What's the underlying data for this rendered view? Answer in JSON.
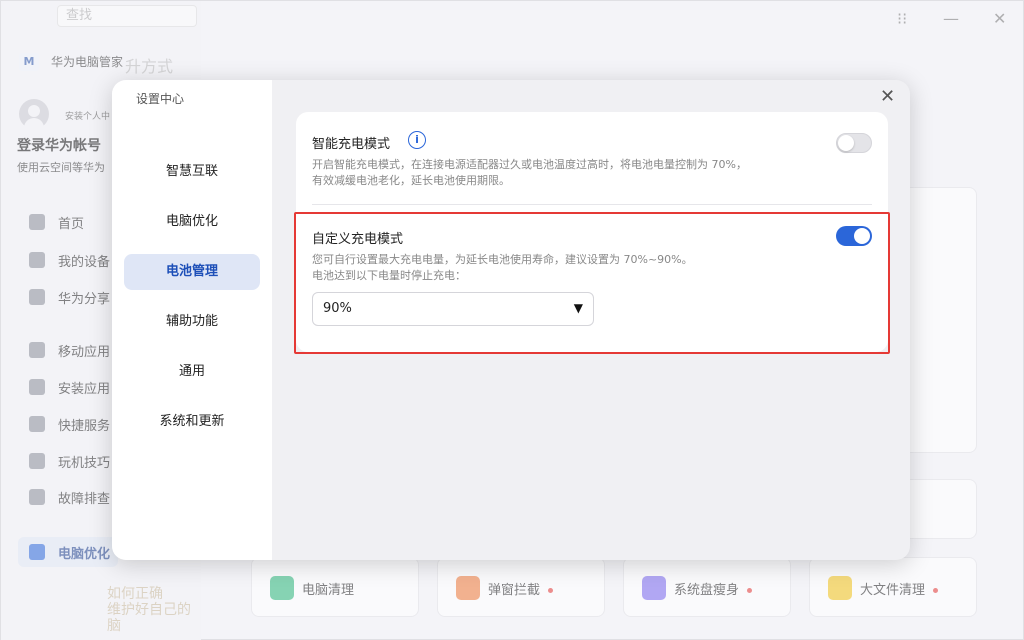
{
  "main_app": {
    "search_placeholder": "查找",
    "logo_text": "M",
    "app_name": "华为电脑管家",
    "install_note": "安装个人中",
    "login_title": "登录华为帐号",
    "cloud_note": "使用云空间等华为",
    "nav": [
      {
        "label": "首页"
      },
      {
        "label": "我的设备"
      },
      {
        "label": "华为分享"
      },
      {
        "label": "移动应用"
      },
      {
        "label": "安装应用"
      },
      {
        "label": "快捷服务"
      },
      {
        "label": "玩机技巧"
      },
      {
        "label": "故障排查"
      },
      {
        "label": "电脑优化"
      }
    ],
    "bg_heading": "升方式",
    "bg_promo_line1": "如何正确",
    "bg_promo_line2": "维护好自己的",
    "bg_promo_line3": "脑",
    "tiles": [
      {
        "label": "电脑清理",
        "dot": false,
        "color": "#2db87a"
      },
      {
        "label": "弹窗拦截",
        "dot": true,
        "color": "#f07a3a"
      },
      {
        "label": "系统盘瘦身",
        "dot": true,
        "color": "#7b68ee"
      },
      {
        "label": "大文件清理",
        "dot": true,
        "color": "#f5c518"
      }
    ]
  },
  "window_controls": {
    "grid": "⁝⁝",
    "minimize": "—",
    "close": "✕"
  },
  "settings": {
    "title": "设置中心",
    "close": "✕",
    "menu": [
      {
        "label": "智慧互联",
        "active": false
      },
      {
        "label": "电脑优化",
        "active": false
      },
      {
        "label": "电池管理",
        "active": true
      },
      {
        "label": "辅助功能",
        "active": false
      },
      {
        "label": "通用",
        "active": false
      },
      {
        "label": "系统和更新",
        "active": false
      }
    ],
    "smart_charge": {
      "title": "智能充电模式",
      "info_icon": "i",
      "desc_line1": "开启智能充电模式，在连接电源适配器过久或电池温度过高时，将电池电量控制为 70%，",
      "desc_line2": "有效减缓电池老化，延长电池使用期限。",
      "enabled": false
    },
    "custom_charge": {
      "title": "自定义充电模式",
      "desc_line1": "您可自行设置最大充电电量，为延长电池使用寿命，建议设置为 70%~90%。",
      "desc_line2": "电池达到以下电量时停止充电：",
      "enabled": true,
      "selected_value": "90%",
      "arrow": "▼"
    }
  },
  "colors": {
    "accent": "#2b66d9",
    "highlight": "#e53935"
  }
}
